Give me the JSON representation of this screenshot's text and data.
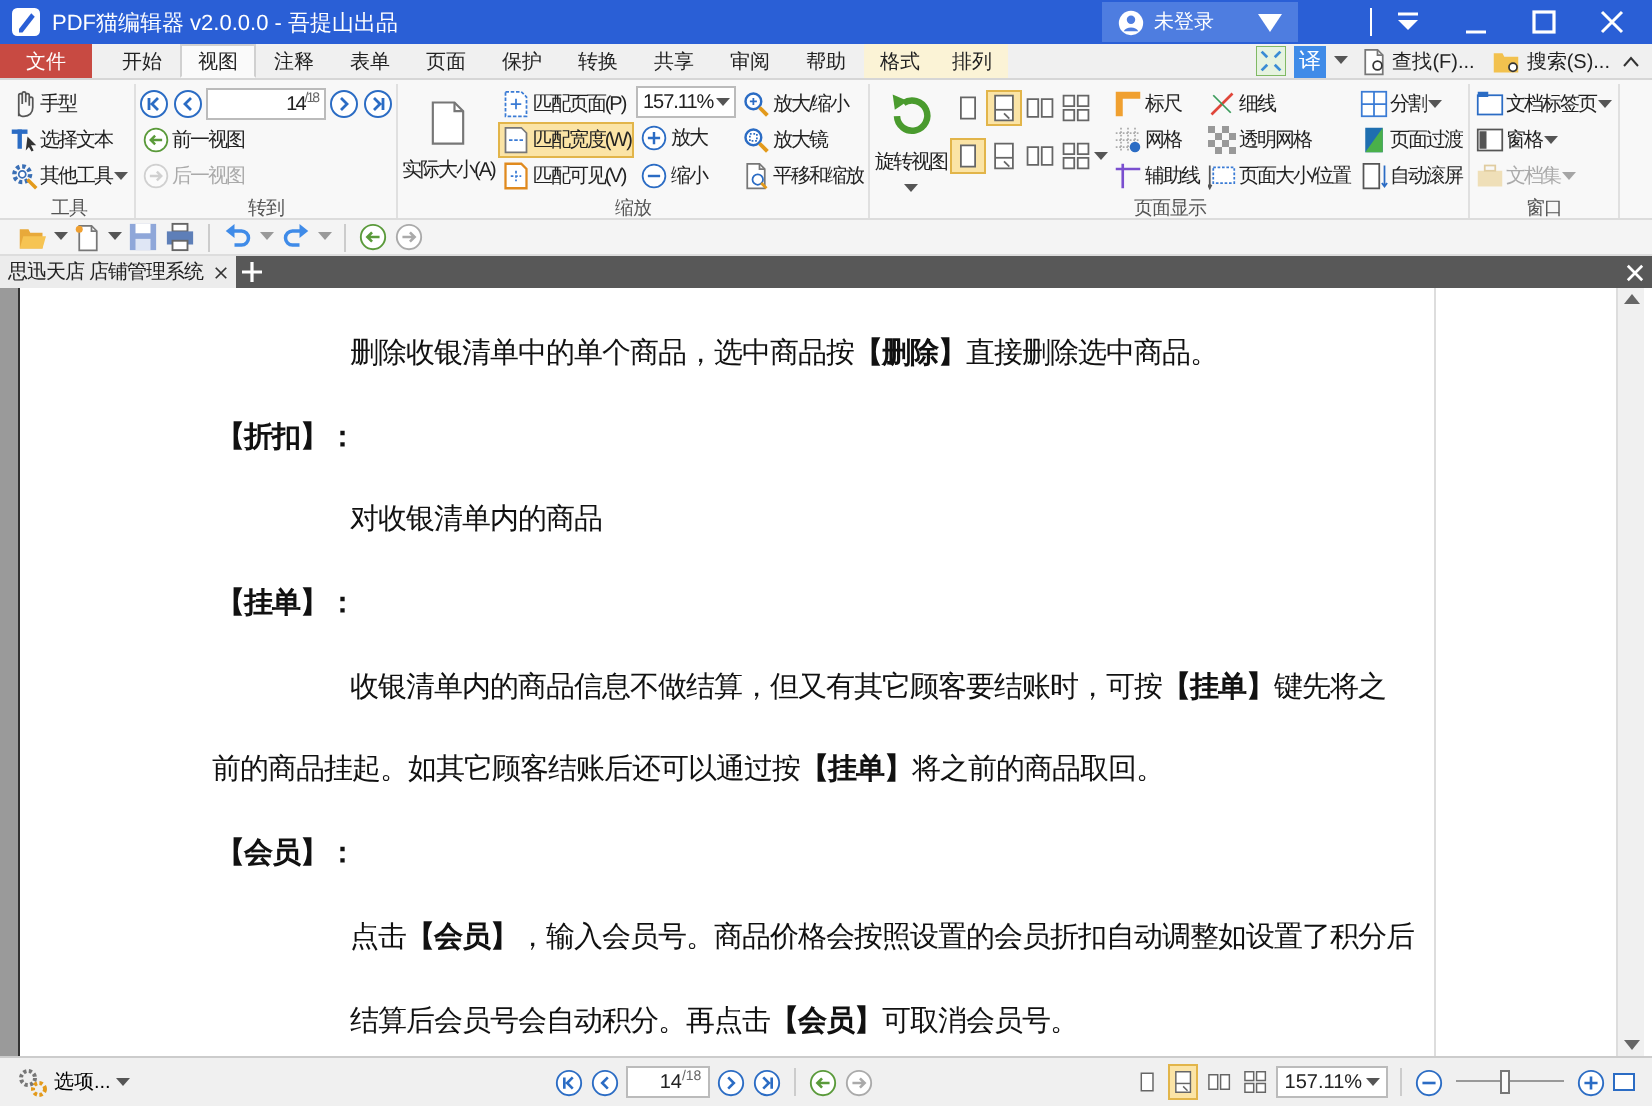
{
  "window": {
    "title": "PDF猫编辑器 v2.0.0.0 - 吾提山出品",
    "account": "未登录"
  },
  "menu_tabs": [
    {
      "label": "文件",
      "kind": "file",
      "selected": false
    },
    {
      "label": "开始",
      "kind": "normal",
      "selected": false
    },
    {
      "label": "视图",
      "kind": "normal",
      "selected": true
    },
    {
      "label": "注释",
      "kind": "normal",
      "selected": false
    },
    {
      "label": "表单",
      "kind": "normal",
      "selected": false
    },
    {
      "label": "页面",
      "kind": "normal",
      "selected": false
    },
    {
      "label": "保护",
      "kind": "normal",
      "selected": false
    },
    {
      "label": "转换",
      "kind": "normal",
      "selected": false
    },
    {
      "label": "共享",
      "kind": "normal",
      "selected": false
    },
    {
      "label": "审阅",
      "kind": "normal",
      "selected": false
    },
    {
      "label": "帮助",
      "kind": "normal",
      "selected": false
    },
    {
      "label": "格式",
      "kind": "context",
      "selected": false
    },
    {
      "label": "排列",
      "kind": "context",
      "selected": false
    }
  ],
  "tab_row_tools": {
    "translate": "译",
    "find": "查找(F)...",
    "search": "搜索(S)..."
  },
  "ribbon": [
    {
      "title": "工具",
      "columns": [
        [
          {
            "kind": "small",
            "label": "手型"
          },
          {
            "kind": "small",
            "label": "选择文本"
          },
          {
            "kind": "small",
            "label": "其他工具",
            "dropdown": true
          }
        ]
      ]
    },
    {
      "title": "转到",
      "columns": [
        [
          {
            "kind": "pager",
            "page": "14",
            "total": "/18"
          },
          {
            "kind": "small",
            "label": "前一视图",
            "disabled": false
          },
          {
            "kind": "small",
            "label": "后一视图",
            "disabled": true
          }
        ]
      ]
    },
    {
      "title": "缩放",
      "columns": [
        [
          {
            "kind": "large",
            "label": "实际大小(A)"
          }
        ],
        [
          {
            "kind": "small",
            "label": "匹配页面(P)",
            "selected": false
          },
          {
            "kind": "small",
            "label": "匹配宽度(W)",
            "selected": true
          },
          {
            "kind": "small",
            "label": "匹配可见(V)",
            "selected": false
          }
        ],
        [
          {
            "kind": "combo",
            "value": "157.11%"
          },
          {
            "kind": "small",
            "label": "放大"
          },
          {
            "kind": "small",
            "label": "缩小"
          }
        ],
        [
          {
            "kind": "small",
            "label": "放大/缩小"
          },
          {
            "kind": "small",
            "label": "放大镜"
          },
          {
            "kind": "small",
            "label": "平移和缩放"
          }
        ]
      ]
    },
    {
      "title": "页面显示",
      "columns": [
        [
          {
            "kind": "large",
            "label": "旋转视图",
            "dropdown": true
          }
        ],
        [
          {
            "kind": "layouts",
            "rows": [
              [
                {
                  "selected": false
                },
                {
                  "selected": true
                },
                {
                  "selected": false
                },
                {
                  "selected": false
                }
              ],
              [
                {
                  "selected": true
                },
                {
                  "selected": false
                },
                {
                  "selected": false
                },
                {
                  "selected": false
                }
              ]
            ]
          }
        ],
        [
          {
            "kind": "small",
            "label": "标尺"
          },
          {
            "kind": "small",
            "label": "网格"
          },
          {
            "kind": "small",
            "label": "辅助线"
          }
        ],
        [
          {
            "kind": "small",
            "label": "细线"
          },
          {
            "kind": "small",
            "label": "透明网格"
          },
          {
            "kind": "small",
            "label": "页面大小/位置"
          }
        ],
        [
          {
            "kind": "small",
            "label": "分割",
            "dropdown": true
          },
          {
            "kind": "small",
            "label": "页面过渡"
          },
          {
            "kind": "small",
            "label": "自动滚屏"
          }
        ]
      ]
    },
    {
      "title": "窗口",
      "columns": [
        [
          {
            "kind": "small",
            "label": "文档标签页",
            "dropdown": true,
            "disabled": false
          },
          {
            "kind": "small",
            "label": "窗格",
            "dropdown": true,
            "disabled": false
          },
          {
            "kind": "small",
            "label": "文档集",
            "dropdown": true,
            "disabled": true
          }
        ]
      ]
    }
  ],
  "doc_tab": {
    "title": "思迅天店 店铺管理系统"
  },
  "document": {
    "lines": [
      {
        "kind": "indent",
        "text": "删除收银清单中的单个商品，选中商品按**【删除】**直接删除选中商品。"
      },
      {
        "kind": "heading",
        "text": "【折扣】："
      },
      {
        "kind": "indent",
        "text": "对收银清单内的商品"
      },
      {
        "kind": "heading",
        "text": "【挂单】："
      },
      {
        "kind": "indent",
        "text": "收银清单内的商品信息不做结算，但又有其它顾客要结账时，可按**【挂单】**键先将之"
      },
      {
        "kind": "plain",
        "text": "前的商品挂起。如其它顾客结账后还可以通过按**【挂单】**将之前的商品取回。"
      },
      {
        "kind": "heading",
        "text": "【会员】："
      },
      {
        "kind": "indent",
        "text": "点击**【会员】**，输入会员号。商品价格会按照设置的会员折扣自动调整如设置了积分后"
      },
      {
        "kind": "indent",
        "text": "结算后会员号会自动积分。再点击**【会员】**可取消会员号。"
      }
    ]
  },
  "status_bar": {
    "options": "选项...",
    "page": "14",
    "total": "/18",
    "layouts": [
      {
        "selected": false
      },
      {
        "selected": true
      },
      {
        "selected": false
      },
      {
        "selected": false
      }
    ],
    "zoom": "157.11%",
    "level": 0.45
  }
}
